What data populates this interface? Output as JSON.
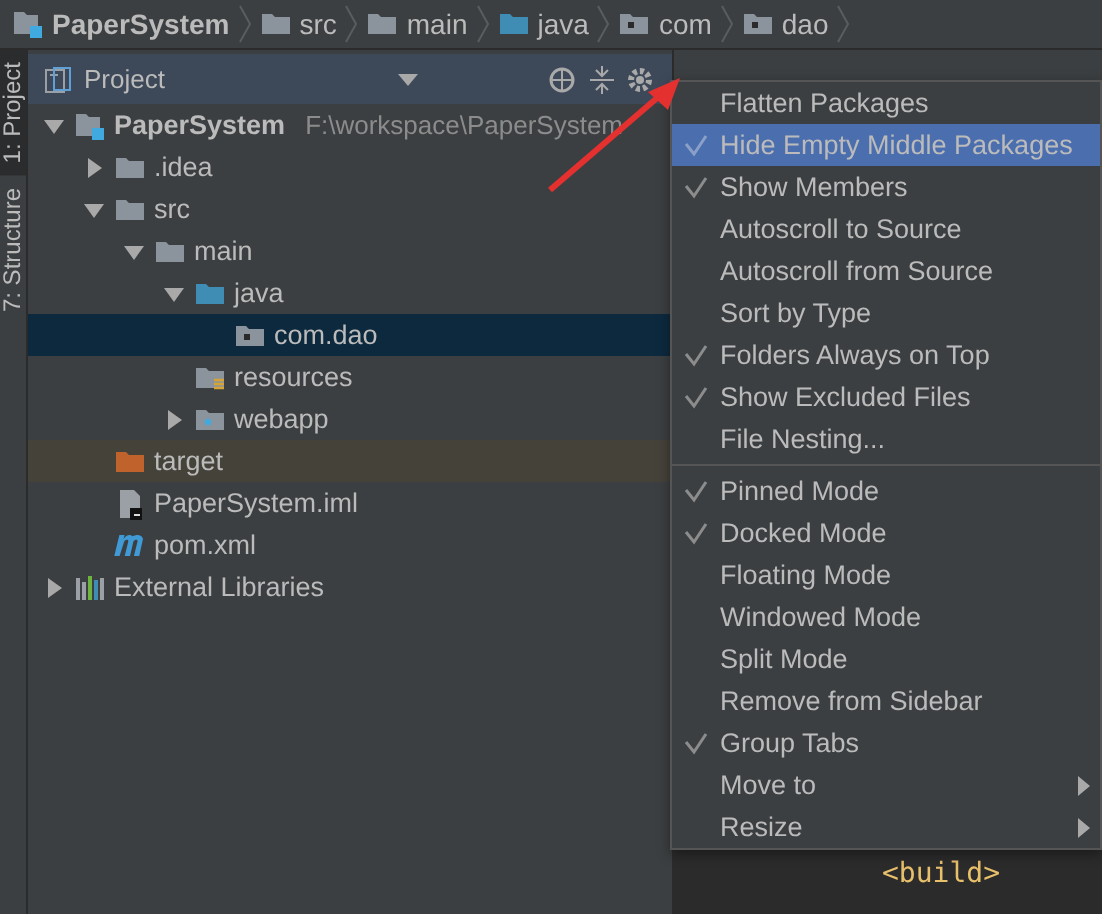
{
  "breadcrumbs": [
    {
      "label": "PaperSystem",
      "kind": "module"
    },
    {
      "label": "src",
      "kind": "folder"
    },
    {
      "label": "main",
      "kind": "folder"
    },
    {
      "label": "java",
      "kind": "source-folder"
    },
    {
      "label": "com",
      "kind": "package"
    },
    {
      "label": "dao",
      "kind": "package"
    }
  ],
  "tool_strip": [
    {
      "label": "1: Project",
      "selected": true
    },
    {
      "label": "7: Structure",
      "selected": false
    }
  ],
  "project_panel": {
    "title": "Project",
    "tree": [
      {
        "label": "PaperSystem",
        "path": "F:\\workspace\\PaperSystem",
        "kind": "module",
        "expanded": true,
        "selected": false,
        "children": [
          {
            "label": ".idea",
            "kind": "folder",
            "expanded": false,
            "selected": false
          },
          {
            "label": "src",
            "kind": "folder",
            "expanded": true,
            "selected": false,
            "children": [
              {
                "label": "main",
                "kind": "folder",
                "expanded": true,
                "selected": false,
                "children": [
                  {
                    "label": "java",
                    "kind": "source-folder",
                    "expanded": true,
                    "selected": false,
                    "children": [
                      {
                        "label": "com.dao",
                        "kind": "package",
                        "selected": true
                      }
                    ]
                  },
                  {
                    "label": "resources",
                    "kind": "resources-folder",
                    "selected": false
                  },
                  {
                    "label": "webapp",
                    "kind": "web-folder",
                    "expanded": false,
                    "selected": false
                  }
                ]
              }
            ]
          },
          {
            "label": "target",
            "kind": "excluded-folder",
            "selected": false
          },
          {
            "label": "PaperSystem.iml",
            "kind": "file",
            "selected": false
          },
          {
            "label": "pom.xml",
            "kind": "maven",
            "selected": false
          }
        ]
      },
      {
        "label": "External Libraries",
        "kind": "libraries",
        "expanded": false,
        "selected": false
      }
    ]
  },
  "editor": {
    "lines": [
      "<build>"
    ]
  },
  "menu": {
    "groups": [
      [
        {
          "label": "Flatten Packages",
          "checked": false,
          "selected": false,
          "submenu": false
        },
        {
          "label": "Hide Empty Middle Packages",
          "checked": true,
          "selected": true,
          "submenu": false
        },
        {
          "label": "Show Members",
          "checked": true,
          "selected": false,
          "submenu": false
        },
        {
          "label": "Autoscroll to Source",
          "checked": false,
          "selected": false,
          "submenu": false
        },
        {
          "label": "Autoscroll from Source",
          "checked": false,
          "selected": false,
          "submenu": false
        },
        {
          "label": "Sort by Type",
          "checked": false,
          "selected": false,
          "submenu": false
        },
        {
          "label": "Folders Always on Top",
          "checked": true,
          "selected": false,
          "submenu": false
        },
        {
          "label": "Show Excluded Files",
          "checked": true,
          "selected": false,
          "submenu": false
        },
        {
          "label": "File Nesting...",
          "checked": false,
          "selected": false,
          "submenu": false
        }
      ],
      [
        {
          "label": "Pinned Mode",
          "checked": true,
          "selected": false,
          "submenu": false
        },
        {
          "label": "Docked Mode",
          "checked": true,
          "selected": false,
          "submenu": false
        },
        {
          "label": "Floating Mode",
          "checked": false,
          "selected": false,
          "submenu": false
        },
        {
          "label": "Windowed Mode",
          "checked": false,
          "selected": false,
          "submenu": false
        },
        {
          "label": "Split Mode",
          "checked": false,
          "selected": false,
          "submenu": false
        },
        {
          "label": "Remove from Sidebar",
          "checked": false,
          "selected": false,
          "submenu": false
        },
        {
          "label": "Group Tabs",
          "checked": true,
          "selected": false,
          "submenu": false
        },
        {
          "label": "Move to",
          "checked": false,
          "selected": false,
          "submenu": true
        },
        {
          "label": "Resize",
          "checked": false,
          "selected": false,
          "submenu": true
        }
      ]
    ]
  }
}
